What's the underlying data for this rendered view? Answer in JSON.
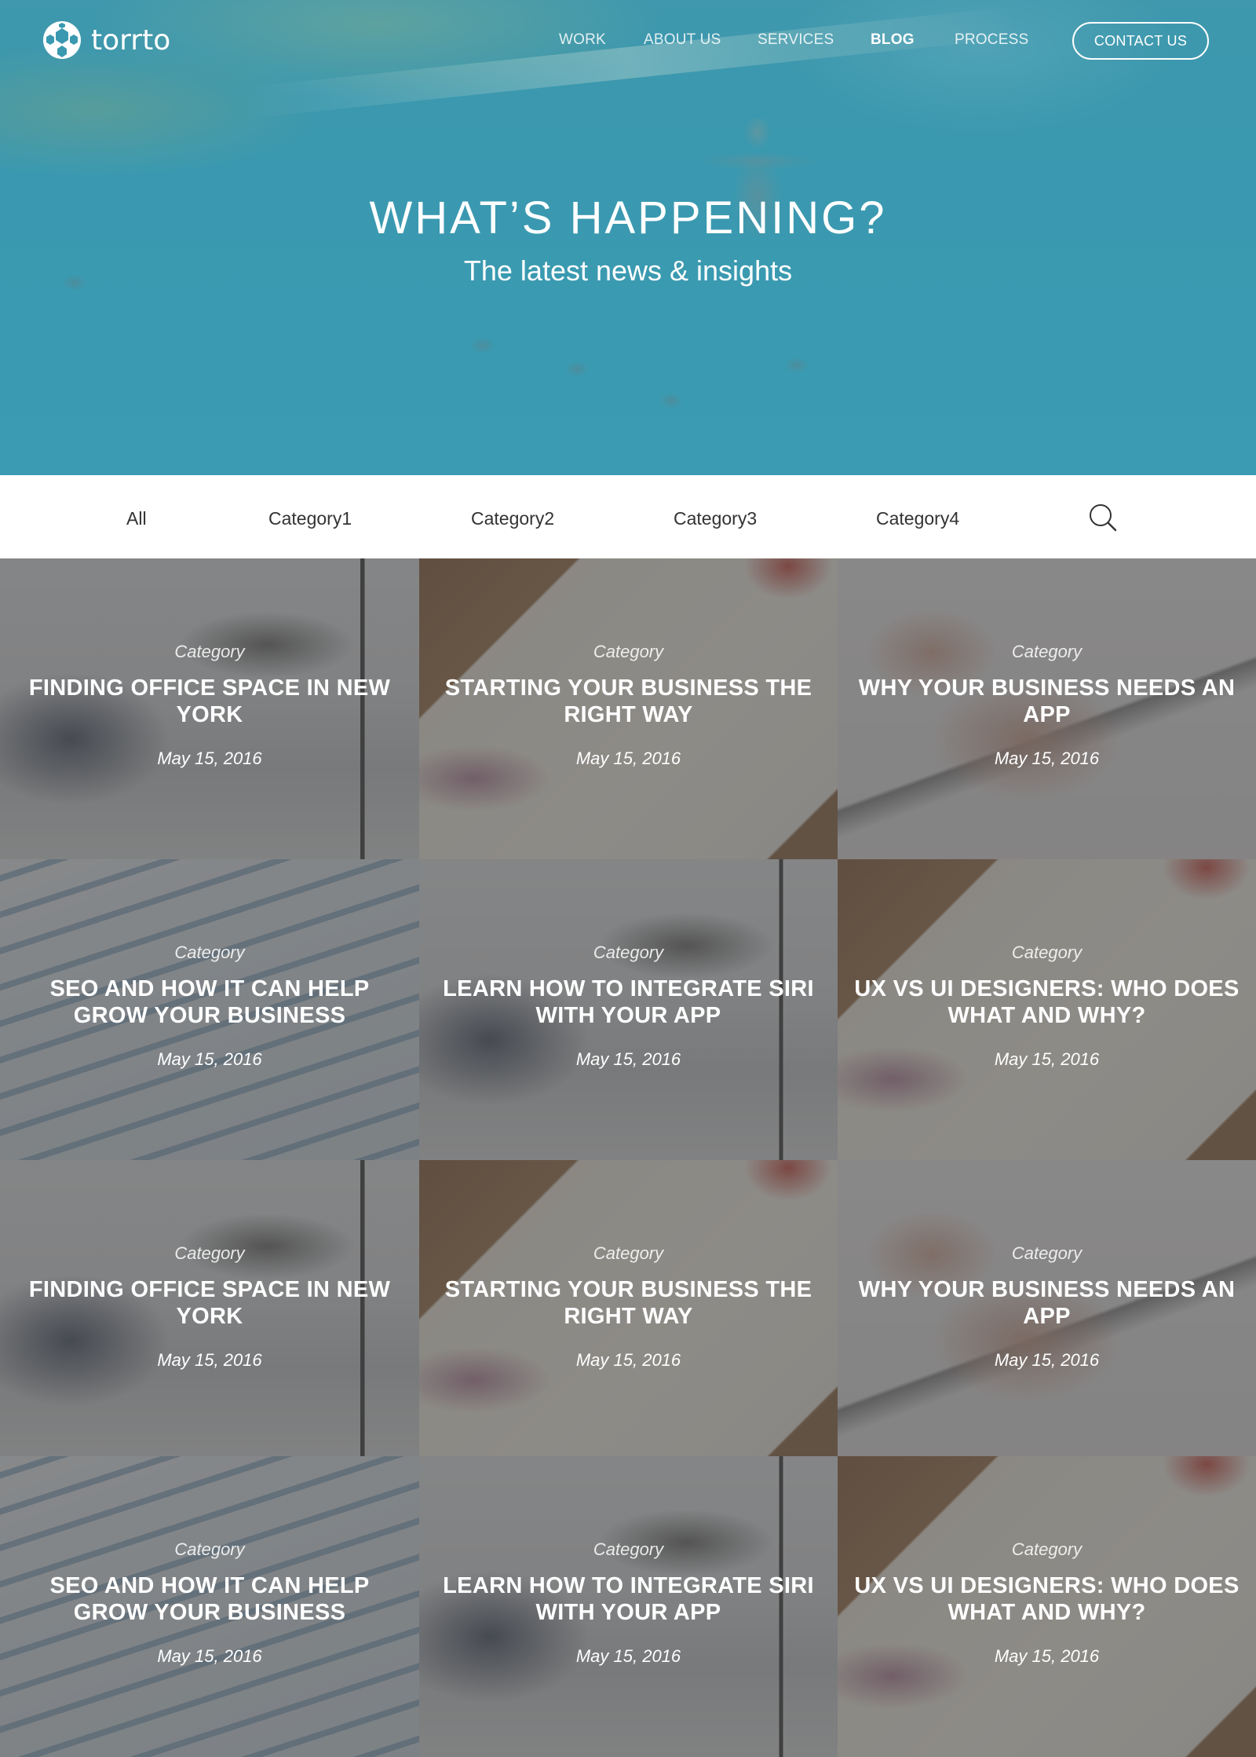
{
  "brand": {
    "name": "torrto"
  },
  "nav": {
    "items": [
      "WORK",
      "ABOUT US",
      "SERVICES",
      "BLOG",
      "PROCESS"
    ],
    "active": "BLOG",
    "contact_label": "CONTACT US"
  },
  "hero": {
    "title": "WHAT’S HAPPENING?",
    "subtitle": "The latest news & insights"
  },
  "categories": [
    "All",
    "Category1",
    "Category2",
    "Category3",
    "Category4"
  ],
  "posts": [
    {
      "category": "Category",
      "title": "FINDING OFFICE SPACE IN NEW YORK",
      "date": "May 15, 2016",
      "image": "office"
    },
    {
      "category": "Category",
      "title": "STARTING YOUR BUSINESS THE RIGHT WAY",
      "date": "May 15, 2016",
      "image": "sketch"
    },
    {
      "category": "Category",
      "title": "WHY YOUR BUSINESS NEEDS AN APP",
      "date": "May 15, 2016",
      "image": "phone"
    },
    {
      "category": "Category",
      "title": "SEO AND HOW IT CAN HELP GROW YOUR BUSINESS",
      "date": "May 15, 2016",
      "image": "seo"
    },
    {
      "category": "Category",
      "title": "LEARN HOW TO INTEGRATE SIRI WITH YOUR APP",
      "date": "May 15, 2016",
      "image": "office"
    },
    {
      "category": "Category",
      "title": "UX VS UI DESIGNERS: WHO DOES WHAT AND WHY?",
      "date": "May 15, 2016",
      "image": "sketch"
    },
    {
      "category": "Category",
      "title": "FINDING OFFICE SPACE IN NEW YORK",
      "date": "May 15, 2016",
      "image": "office"
    },
    {
      "category": "Category",
      "title": "STARTING YOUR BUSINESS THE RIGHT WAY",
      "date": "May 15, 2016",
      "image": "sketch"
    },
    {
      "category": "Category",
      "title": "WHY YOUR BUSINESS NEEDS AN APP",
      "date": "May 15, 2016",
      "image": "phone"
    },
    {
      "category": "Category",
      "title": "SEO AND HOW IT CAN HELP GROW YOUR BUSINESS",
      "date": "May 15, 2016",
      "image": "seo"
    },
    {
      "category": "Category",
      "title": "LEARN HOW TO INTEGRATE SIRI WITH YOUR APP",
      "date": "May 15, 2016",
      "image": "office"
    },
    {
      "category": "Category",
      "title": "UX VS UI DESIGNERS: WHO DOES WHAT AND WHY?",
      "date": "May 15, 2016",
      "image": "sketch"
    }
  ],
  "icons": {
    "search": "search-icon",
    "logo": "logo-mark-icon"
  },
  "colors": {
    "hero": "#3a9bb2",
    "overlay": "#505050",
    "text": "#ffffff"
  }
}
